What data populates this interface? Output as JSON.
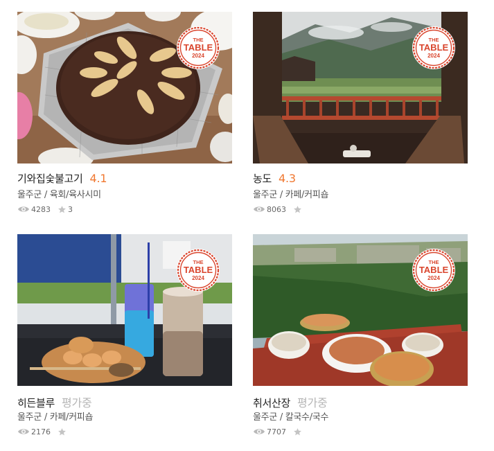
{
  "badge": {
    "line1": "THE",
    "line2": "TABLE",
    "line3": "2024",
    "color": "#d9452d"
  },
  "colors": {
    "rating": "#f0772f",
    "pending": "#b5b5b5",
    "icon": "#b9b9b9"
  },
  "cards": [
    {
      "name": "기와집숯불고기",
      "rating": "4.1",
      "region": "울주군",
      "category": "육회/육사시미",
      "views": "4283",
      "favorites": "3",
      "photo": "bulgogi-grill-photo"
    },
    {
      "name": "농도",
      "rating": "4.3",
      "region": "울주군",
      "category": "카페/커피숍",
      "views": "8063",
      "favorites": "",
      "photo": "mountain-view-cafe-photo"
    },
    {
      "name": "히든블루",
      "rating": "평가중",
      "region": "울주군",
      "category": "카페/커피숍",
      "views": "2176",
      "favorites": "",
      "photo": "blue-drinks-photo"
    },
    {
      "name": "취서산장",
      "rating": "평가중",
      "region": "울주군",
      "category": "칼국수/국수",
      "views": "7707",
      "favorites": "",
      "photo": "noodle-mountain-photo"
    }
  ]
}
